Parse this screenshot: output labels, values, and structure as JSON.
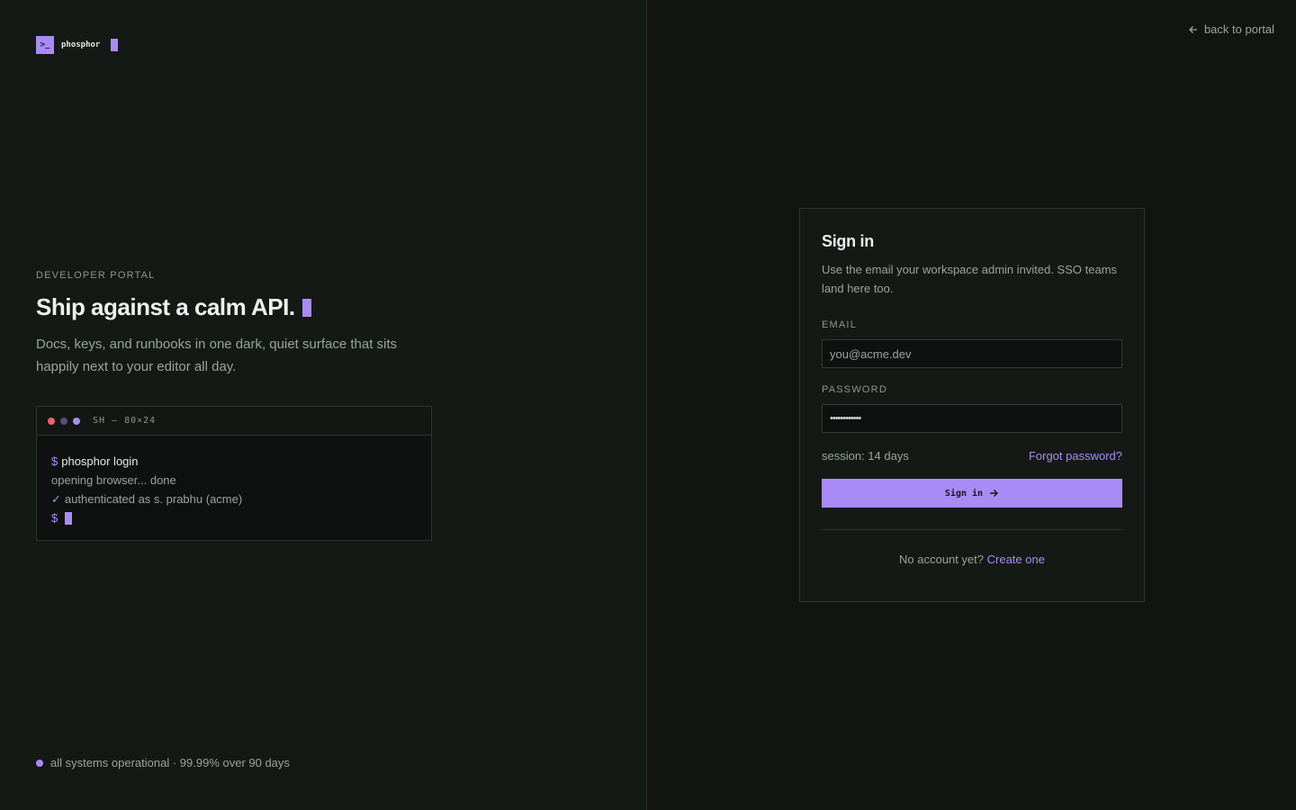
{
  "brand": {
    "name": "phosphor",
    "mark": ">_",
    "accent": "#a98bf5"
  },
  "hero": {
    "eyebrow": "DEVELOPER PORTAL",
    "headline": "Ship against a calm API.",
    "lede": "Docs, keys, and runbooks in one dark, quiet surface that sits happily next to your editor all day."
  },
  "terminal": {
    "title": "SH — 80×24",
    "lines": {
      "cmd": "phosphor login",
      "output": "opening browser... done",
      "auth": "authenticated as s. prabhu (acme)"
    },
    "prompt": "$",
    "check": "✓"
  },
  "status": {
    "text": "all systems operational · 99.99% over 90 days"
  },
  "nav": {
    "back_label": "back to portal"
  },
  "signin": {
    "title": "Sign in",
    "subtitle": "Use the email your workspace admin invited. SSO teams land here too.",
    "email_label": "EMAIL",
    "email_placeholder": "you@acme.dev",
    "password_label": "PASSWORD",
    "password_value": "••••••••••••",
    "session": "session: 14 days",
    "forgot": "Forgot password?",
    "submit": "Sign in",
    "no_account": "No account yet?",
    "create": "Create one"
  }
}
